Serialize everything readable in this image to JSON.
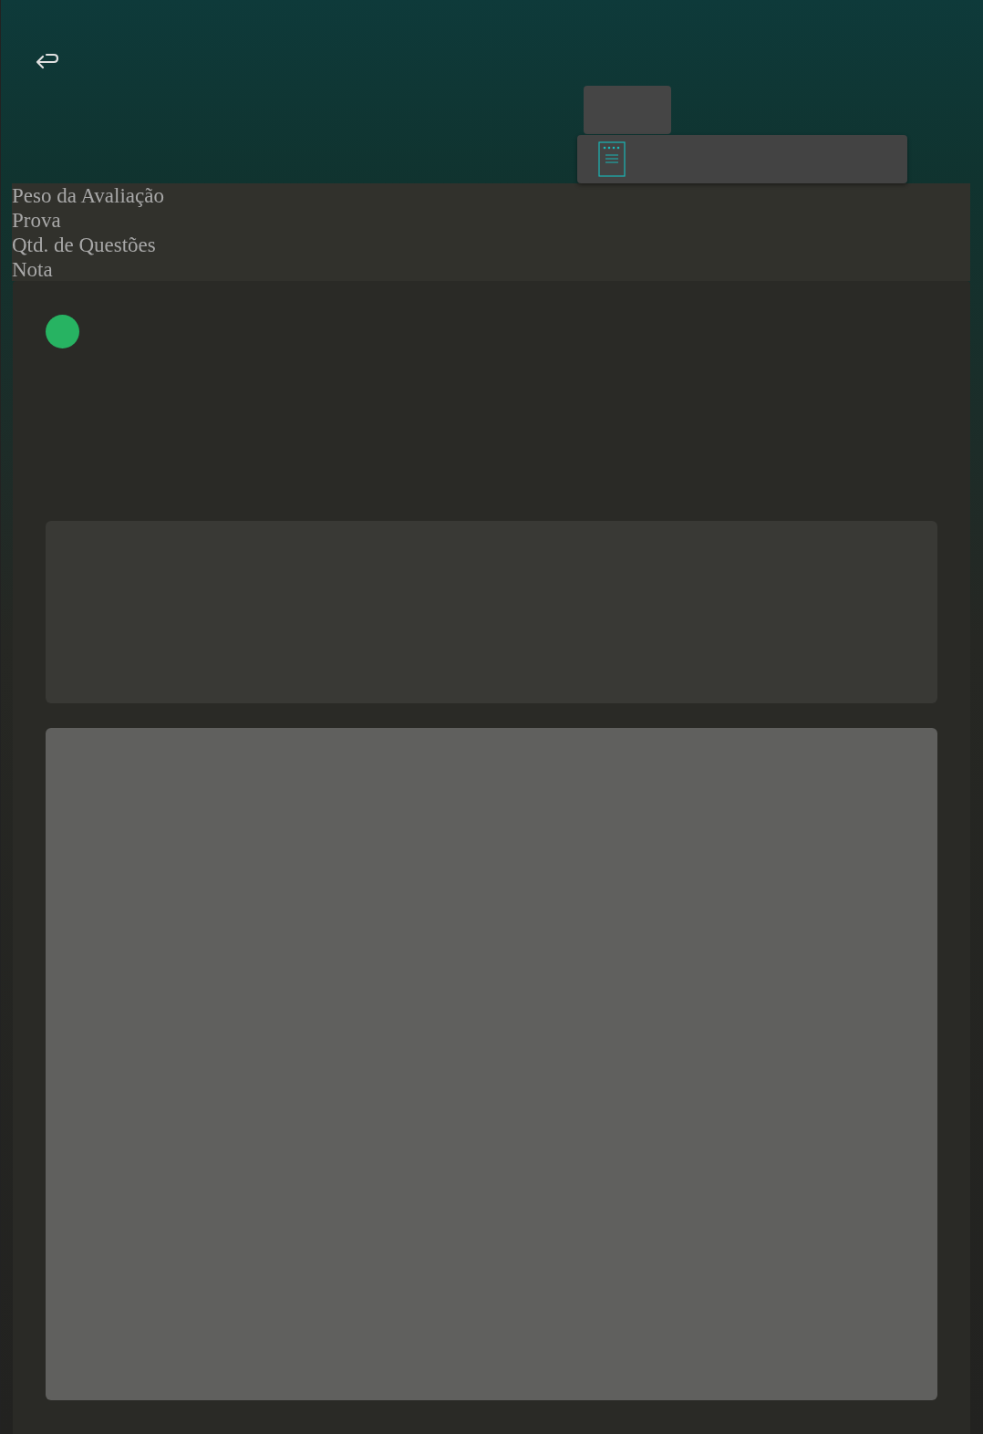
{
  "info_labels": [
    "Peso da Avaliação",
    "Prova",
    "Qtd. de Questões",
    "Nota"
  ],
  "status_dot": {
    "color": "#27b362"
  }
}
